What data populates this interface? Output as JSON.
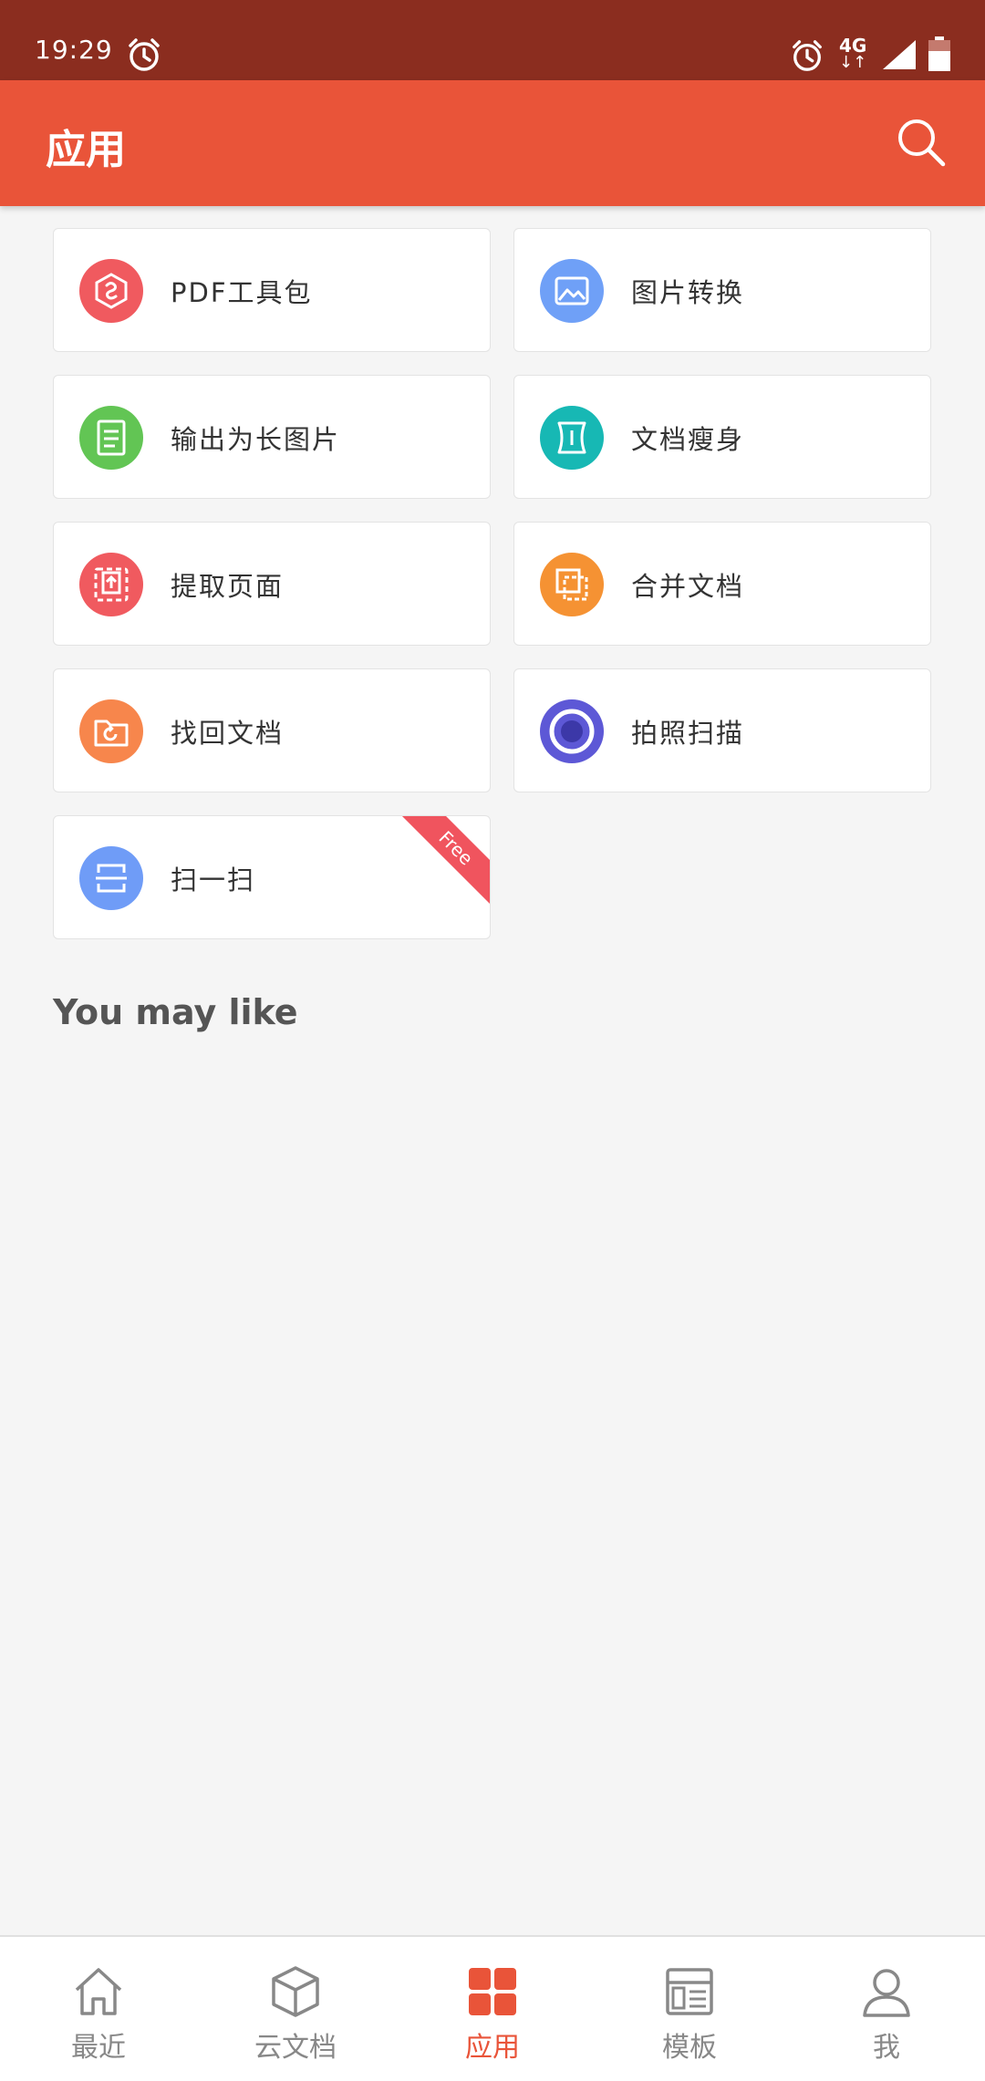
{
  "status_bar": {
    "time": "19:29",
    "network": "4G"
  },
  "app_bar": {
    "title": "应用"
  },
  "tools": [
    {
      "label": "PDF工具包",
      "icon": "pdf-hexagon-icon",
      "color": "#f05a5f"
    },
    {
      "label": "图片转换",
      "icon": "image-icon",
      "color": "#6fa0f7"
    },
    {
      "label": "输出为长图片",
      "icon": "long-image-icon",
      "color": "#62c554"
    },
    {
      "label": "文档瘦身",
      "icon": "document-slim-icon",
      "color": "#17b8b4"
    },
    {
      "label": "提取页面",
      "icon": "extract-page-icon",
      "color": "#f05a5f"
    },
    {
      "label": "合并文档",
      "icon": "merge-document-icon",
      "color": "#f59233"
    },
    {
      "label": "找回文档",
      "icon": "recover-folder-icon",
      "color": "#f7864c"
    },
    {
      "label": "拍照扫描",
      "icon": "camera-scan-icon",
      "color": "#5d58d6"
    },
    {
      "label": "扫一扫",
      "icon": "scan-icon",
      "color": "#6f9cf7",
      "badge": "Free"
    }
  ],
  "section": {
    "you_may_like": "You may like"
  },
  "bottom_nav": [
    {
      "label": "最近",
      "icon": "home-icon"
    },
    {
      "label": "云文档",
      "icon": "cloud-doc-cube-icon"
    },
    {
      "label": "应用",
      "icon": "apps-grid-icon",
      "active": true
    },
    {
      "label": "模板",
      "icon": "template-icon"
    },
    {
      "label": "我",
      "icon": "profile-icon"
    }
  ],
  "colors": {
    "status_bar": "#8b2d1f",
    "accent": "#e95439",
    "background": "#f5f5f5"
  }
}
